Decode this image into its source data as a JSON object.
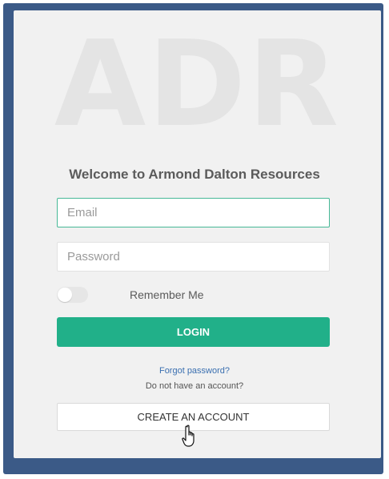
{
  "watermark_text": "ADR",
  "welcome_text": "Welcome to Armond Dalton Resources",
  "email": {
    "placeholder": "Email",
    "value": ""
  },
  "password": {
    "placeholder": "Password",
    "value": ""
  },
  "remember_me": {
    "label": "Remember Me",
    "checked": false
  },
  "login_label": "LOGIN",
  "forgot_password": "Forgot password?",
  "no_account_text": "Do not have an account?",
  "create_account_label": "CREATE AN ACCOUNT",
  "colors": {
    "frame": "#3b5a87",
    "card": "#f1f1f1",
    "accent": "#21b089",
    "link": "#3a6fb0"
  },
  "icons": {
    "cursor": "hand-pointer-icon"
  }
}
